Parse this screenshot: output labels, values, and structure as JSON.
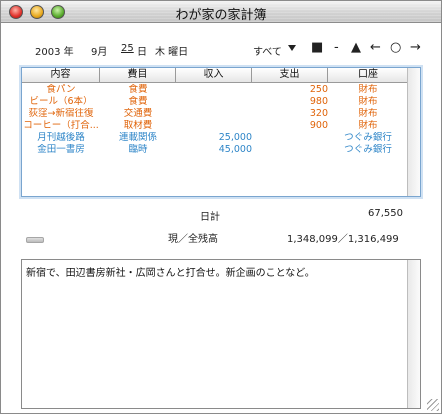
{
  "window": {
    "title": "わが家の家計簿"
  },
  "date": {
    "year": "2003 年",
    "month": "9月",
    "day": "25",
    "day_label": "日",
    "weekday": "木 曜日"
  },
  "toolbar": {
    "filter_label": "すべて",
    "filter_arrow_icon": "triangle-down-icon",
    "square": "■",
    "dash": "-",
    "triangle": "▲",
    "arrow_left": "←",
    "circle": "○",
    "arrow_right": "→"
  },
  "table": {
    "columns": [
      "内容",
      "費目",
      "収入",
      "支出",
      "口座"
    ],
    "rows": [
      {
        "content": "食パン",
        "category": "食費",
        "income": "",
        "expense": "250",
        "account": "財布",
        "kind": "expense"
      },
      {
        "content": "ビール（6本）",
        "category": "食費",
        "income": "",
        "expense": "980",
        "account": "財布",
        "kind": "expense"
      },
      {
        "content": "荻窪→新宿往復",
        "category": "交通費",
        "income": "",
        "expense": "320",
        "account": "財布",
        "kind": "expense"
      },
      {
        "content": "コーヒー（打合...",
        "category": "取材費",
        "income": "",
        "expense": "900",
        "account": "財布",
        "kind": "expense"
      },
      {
        "content": "月刊越後路",
        "category": "連載関係",
        "income": "25,000",
        "expense": "",
        "account": "つぐみ銀行",
        "kind": "income"
      },
      {
        "content": "金田一書房",
        "category": "臨時",
        "income": "45,000",
        "expense": "",
        "account": "つぐみ銀行",
        "kind": "income"
      }
    ]
  },
  "summary": {
    "daily_label": "日計",
    "daily_value": "67,550",
    "balance_label": "現／全残高",
    "balance_value": "1,348,099／1,316,499"
  },
  "memo": {
    "text": "新宿で、田辺書房新社・広岡さんと打合せ。新企画のことなど。"
  },
  "colors": {
    "expense": "#e0640a",
    "income": "#2f86c8",
    "table_border": "#7aa5cf"
  }
}
